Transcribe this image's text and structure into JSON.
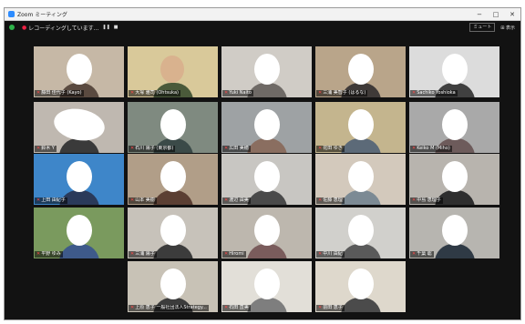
{
  "window": {
    "title": "Zoom ミーティング",
    "controls": [
      "−",
      "□",
      "✕"
    ]
  },
  "toolbar": {
    "recording_label": "レコーディングしています...",
    "pause": "❚❚",
    "stop": "■",
    "button_right": "ミュート",
    "view_label": "⊞ 表示"
  },
  "participants": [
    {
      "name": "藤田 佳代子 (Kayo)",
      "wall": "#c6b8a6",
      "clothes": "#5a4a40",
      "face": true
    },
    {
      "name": "大塚 雅司 (Ohtsuka)",
      "wall": "#d9c99a",
      "clothes": "#4a5a3a",
      "face": false,
      "speaking": true
    },
    {
      "name": "Yuki Naito",
      "wall": "#d0ccc6",
      "clothes": "#6f6a66",
      "face": true
    },
    {
      "name": "三浦 美智子 (はるな)",
      "wall": "#b9a58a",
      "clothes": "#3f3a38",
      "face": true
    },
    {
      "name": "Sachiko Yoshioka",
      "wall": "#dcdcdc",
      "clothes": "#404040",
      "face": true
    },
    {
      "name": "鈴木 Y",
      "wall": "#bfb8b0",
      "clothes": "#3a3a3a",
      "face": true,
      "wide": true
    },
    {
      "name": "石川 陽子 (東京都)",
      "wall": "#7f8a80",
      "clothes": "#3b4a48",
      "face": true
    },
    {
      "name": "広田 美穂",
      "wall": "#9ea2a4",
      "clothes": "#8a6e60",
      "face": true
    },
    {
      "name": "花田 ゆき",
      "wall": "#c4b58e",
      "clothes": "#5c6a78",
      "face": true
    },
    {
      "name": "Keiko M (Miho)",
      "wall": "#a9a9a9",
      "clothes": "#6d5b5b",
      "face": true
    },
    {
      "name": "上田 由紀子",
      "wall": "#3e86c9",
      "clothes": "#2a3a5a",
      "face": true
    },
    {
      "name": "山本 美樹",
      "wall": "#b19e88",
      "clothes": "#5b3f33",
      "face": true
    },
    {
      "name": "渡辺 由美",
      "wall": "#c8c6c2",
      "clothes": "#4a4a4a",
      "face": true
    },
    {
      "name": "佐藤 恵理",
      "wall": "#d3c9bc",
      "clothes": "#7c8a94",
      "face": true
    },
    {
      "name": "中島 恵理子",
      "wall": "#b8b4ae",
      "clothes": "#2e2e2e",
      "face": true
    },
    {
      "name": "平野 ゆみ",
      "wall": "#7a9a5e",
      "clothes": "#3e5a8a",
      "face": true
    },
    {
      "name": "三浦 陽子",
      "wall": "#c7c2ba",
      "clothes": "#3c3c3c",
      "face": true
    },
    {
      "name": "Hiromi",
      "wall": "#bdb7ae",
      "clothes": "#7a5c5c",
      "face": true
    },
    {
      "name": "中川 由紀",
      "wall": "#d1d0cc",
      "clothes": "#5a5a5a",
      "face": true
    },
    {
      "name": "千葉 聡",
      "wall": "#b7b5b0",
      "clothes": "#2f3a45",
      "face": true
    },
    {
      "name": "上原 恵子 一般社団法人Strategy...",
      "wall": "#c8c2b6",
      "clothes": "#3c3c3c",
      "face": true
    },
    {
      "name": "石田 直美",
      "wall": "#e2dfd8",
      "clothes": "#7e7e7e",
      "face": true
    },
    {
      "name": "前田 恵子",
      "wall": "#ded8cc",
      "clothes": "#4b4b4b",
      "face": true
    }
  ]
}
